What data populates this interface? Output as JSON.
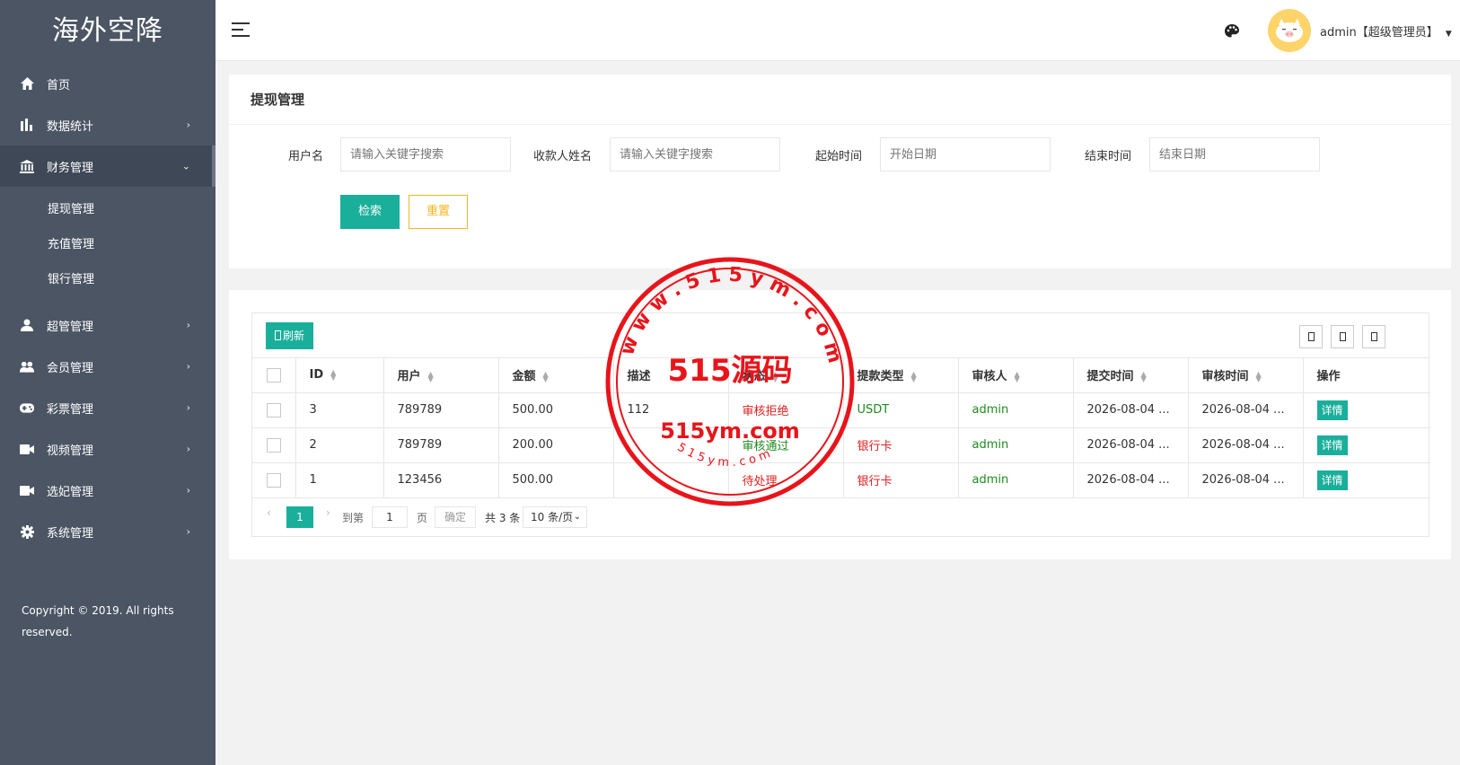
{
  "app": {
    "title": "海外空降"
  },
  "sidebar": {
    "items": [
      {
        "label": "首页",
        "icon": "home-icon",
        "arrow": ""
      },
      {
        "label": "数据统计",
        "icon": "bar-chart-icon",
        "arrow": "›"
      },
      {
        "label": "财务管理",
        "icon": "bank-icon",
        "arrow": "⌄"
      },
      {
        "label": "超管管理",
        "icon": "user-icon",
        "arrow": "›"
      },
      {
        "label": "会员管理",
        "icon": "users-icon",
        "arrow": "›"
      },
      {
        "label": "彩票管理",
        "icon": "gamepad-icon",
        "arrow": "›"
      },
      {
        "label": "视频管理",
        "icon": "video-icon",
        "arrow": "›"
      },
      {
        "label": "选妃管理",
        "icon": "video-icon",
        "arrow": "›"
      },
      {
        "label": "系统管理",
        "icon": "gear-icon",
        "arrow": "›"
      }
    ],
    "sub_items": [
      "提现管理",
      "充值管理",
      "银行管理"
    ],
    "copyright": "Copyright © 2019. All rights reserved."
  },
  "header": {
    "user": "admin【超级管理员】"
  },
  "search_panel": {
    "title": "提现管理",
    "fields": [
      {
        "label": "用户名",
        "placeholder": "请输入关键字搜索"
      },
      {
        "label": "收款人姓名",
        "placeholder": "请输入关键字搜索"
      },
      {
        "label": "起始时间",
        "placeholder": "开始日期"
      },
      {
        "label": "结束时间",
        "placeholder": "结束日期"
      }
    ],
    "search_label": "检索",
    "reset_label": "重置"
  },
  "table": {
    "refresh_label": "刷新",
    "columns": [
      "ID",
      "用户",
      "金额",
      "描述",
      "状态",
      "提款类型",
      "审核人",
      "提交时间",
      "审核时间",
      "操作"
    ],
    "rows": [
      {
        "id": "3",
        "user": "789789",
        "amount": "500.00",
        "desc": "112",
        "status": "审核拒绝",
        "type": "USDT",
        "reviewer": "admin",
        "submit": "2026-08-04 ...",
        "audit": "2026-08-04 ...",
        "action": "详情"
      },
      {
        "id": "2",
        "user": "789789",
        "amount": "200.00",
        "desc": "",
        "status": "审核通过",
        "type": "银行卡",
        "reviewer": "admin",
        "submit": "2026-08-04 ...",
        "audit": "2026-08-04 ...",
        "action": "详情"
      },
      {
        "id": "1",
        "user": "123456",
        "amount": "500.00",
        "desc": "",
        "status": "待处理",
        "type": "银行卡",
        "reviewer": "admin",
        "submit": "2026-08-04 ...",
        "audit": "2026-08-04 ...",
        "action": "详情"
      }
    ],
    "pager": {
      "current": "1",
      "goto_label": "到第",
      "page_input": "1",
      "page_unit": "页",
      "confirm_label": "确定",
      "total": "共 3 条",
      "page_size": "10 条/页"
    }
  },
  "watermark": {
    "main": "515源码",
    "domain": "515ym.com",
    "ring_text": "w w w . 5 1 5 y m . c o m",
    "small_text": "5 1 5 y m . c o m",
    "color": "#e8141a"
  }
}
